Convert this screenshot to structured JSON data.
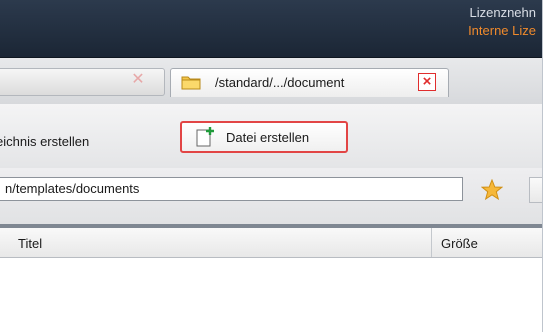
{
  "header": {
    "license_label": "Lizenznehn",
    "license_value": "Interne Lize",
    "accent_color": "#f08a2c"
  },
  "tabs": [
    {
      "label": "",
      "close_icon": "close-icon"
    },
    {
      "label": "/standard/.../document",
      "icon": "folder-icon",
      "close_icon": "close-icon",
      "active": true
    }
  ],
  "toolbar": {
    "create_folder_label": "eichnis erstellen",
    "create_file_label": "Datei erstellen",
    "create_file_icon": "new-file-icon"
  },
  "path": {
    "value": "n/templates/documents",
    "favorite_icon": "star-icon"
  },
  "table": {
    "columns": [
      "Titel",
      "Größe"
    ],
    "rows": []
  }
}
